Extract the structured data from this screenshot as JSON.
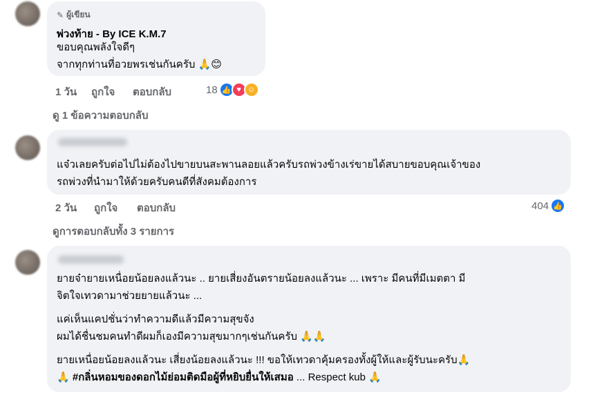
{
  "comment1": {
    "badge": "ผู้เขียน",
    "author": "พ่วงท้าย - By ICE K.M.7",
    "lines": [
      "ขอบคุณพลังใจดีๆ",
      "จากทุกท่านที่อวยพรเช่นกันครับ 🙏😊"
    ],
    "time": "1 วัน",
    "like": "ถูกใจ",
    "reply": "ตอบกลับ",
    "react_count": "18"
  },
  "replies1": "ดู 1 ข้อความตอบกลับ",
  "comment2": {
    "lines": [
      "แจ๋วเลยครับต่อไปไม่ต้องไปขายบนสะพานลอยแล้วครับรถพ่วงข้างเร่ขายได้สบายขอบคุณเจ้าของ",
      "รถพ่วงที่นำมาให้ด้วยครับคนดีที่สังคมต้องการ"
    ],
    "time": "2 วัน",
    "like": "ถูกใจ",
    "reply": "ตอบกลับ",
    "react_count": "404"
  },
  "replies2": "ดูการตอบกลับทั้ง 3 รายการ",
  "comment3": {
    "lines": [
      "ยายจ๋ายายเหนื่อยน้อยลงแล้วนะ .. ยายเสี่ยงอันตรายน้อยลงแล้วนะ ... เพราะ มีคนที่มีเมตตา มี",
      "จิตใจเทวดามาช่วยยายแล้วนะ ...",
      "แค่เห็นแคปชั่นว่าทำความดีแล้วมีความสุขจัง",
      "ผมได้ชื่นชมคนทำดีผมก็เองมีความสุขมากๆเช่นกันครับ 🙏🙏",
      "ยายเหนื่อยน้อยลงแล้วนะ เสี่ยงน้อยลงแล้วนะ !!! ขอให้เทวดาคุ้มครองทั้งผู้ให้และผู้รับนะครับ🙏"
    ],
    "last_prefix": "🙏 ",
    "hashtag": "#กลิ่นหอมของดอกไม้ย่อมติดมือผู้ที่หยิบยื่นให้เสมอ",
    "last_suffix": " ... Respect kub 🙏"
  },
  "colors": {
    "bubble": "#f0f2f5",
    "meta": "#65676b",
    "like_blue": "#1877f2"
  }
}
